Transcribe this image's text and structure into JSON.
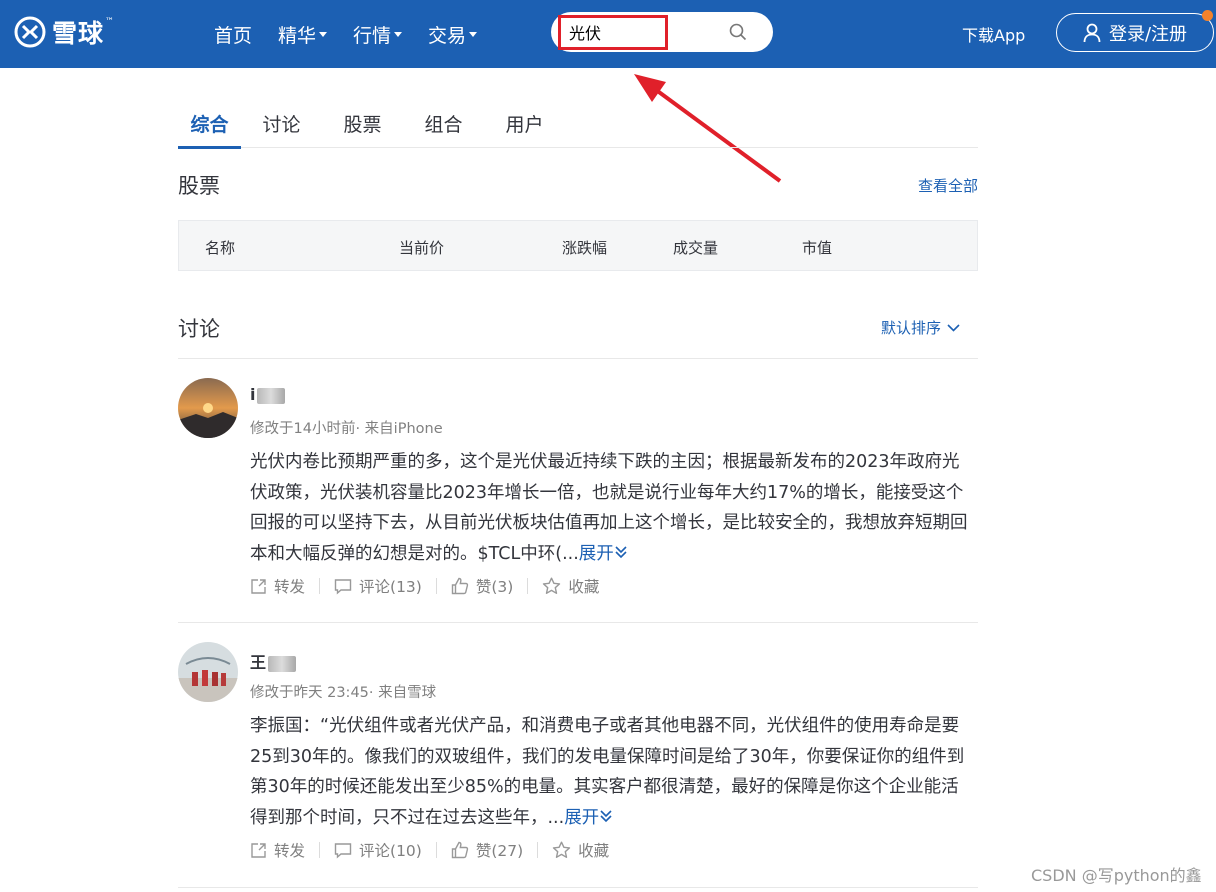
{
  "header": {
    "logo_text": "雪球",
    "logo_tm": "™",
    "nav": [
      {
        "label": "首页",
        "dropdown": false
      },
      {
        "label": "精华",
        "dropdown": true
      },
      {
        "label": "行情",
        "dropdown": true
      },
      {
        "label": "交易",
        "dropdown": true
      }
    ],
    "search_value": "光伏",
    "download_label": "下载App",
    "login_label": "登录/注册",
    "accent_color": "#1c60b3"
  },
  "tabs": [
    "综合",
    "讨论",
    "股票",
    "组合",
    "用户"
  ],
  "stocks_section": {
    "title": "股票",
    "view_all": "查看全部",
    "columns": [
      "名称",
      "当前价",
      "涨跌幅",
      "成交量",
      "市值"
    ]
  },
  "discussion_section": {
    "title": "讨论",
    "sort_label": "默认排序"
  },
  "posts": [
    {
      "username_visible": "i",
      "meta": "修改于14小时前· 来自iPhone",
      "content": "光伏内卷比预期严重的多，这个是光伏最近持续下跌的主因；根据最新发布的2023年政府光伏政策，光伏装机容量比2023年增长一倍，也就是说行业每年大约17%的增长，能接受这个回报的可以坚持下去，从目前光伏板块估值再加上这个增长，是比较安全的，我想放弃短期回本和大幅反弹的幻想是对的。$TCL中环(...",
      "expand": "展开",
      "repost": "转发",
      "comment": "评论(13)",
      "like": "赞(3)",
      "favorite": "收藏"
    },
    {
      "username_visible": "王",
      "meta": "修改于昨天 23:45· 来自雪球",
      "content": "李振国：“光伏组件或者光伏产品，和消费电子或者其他电器不同，光伏组件的使用寿命是要25到30年的。像我们的双玻组件，我们的发电量保障时间是给了30年，你要保证你的组件到第30年的时候还能发出至少85%的电量。其实客户都很清楚，最好的保障是你这个企业能活得到那个时间，只不过在过去这些年，...",
      "expand": "展开",
      "repost": "转发",
      "comment": "评论(10)",
      "like": "赞(27)",
      "favorite": "收藏"
    }
  ],
  "watermark": "CSDN @写python的鑫哥"
}
